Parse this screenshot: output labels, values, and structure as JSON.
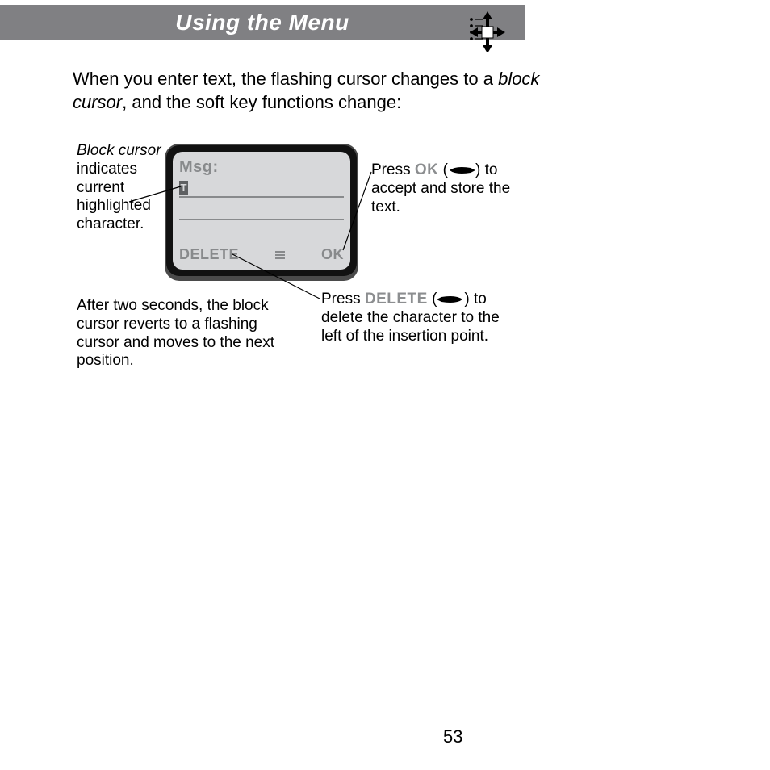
{
  "header": {
    "title": "Using the Menu"
  },
  "intro": {
    "text_before": "When you enter text, the flashing cursor changes to a ",
    "em": "block cursor",
    "text_after": ", and the soft key functions change:"
  },
  "phone": {
    "msg_label": "Msg:",
    "block_char": "T",
    "softkey_left": "DELETE",
    "softkey_right": "OK"
  },
  "callouts": {
    "cursor": {
      "em": "Block cursor",
      "rest": " indicates current highlighted character."
    },
    "ok": {
      "before": "Press ",
      "sk": "OK",
      "after": " to accept and store the text."
    },
    "delete": {
      "before": "Press ",
      "sk": "DELETE",
      "after": " to delete the character to the left of the insertion point."
    },
    "revert": "After two seconds, the block cursor reverts to a flashing cursor and moves to the next position."
  },
  "page_number": "53"
}
